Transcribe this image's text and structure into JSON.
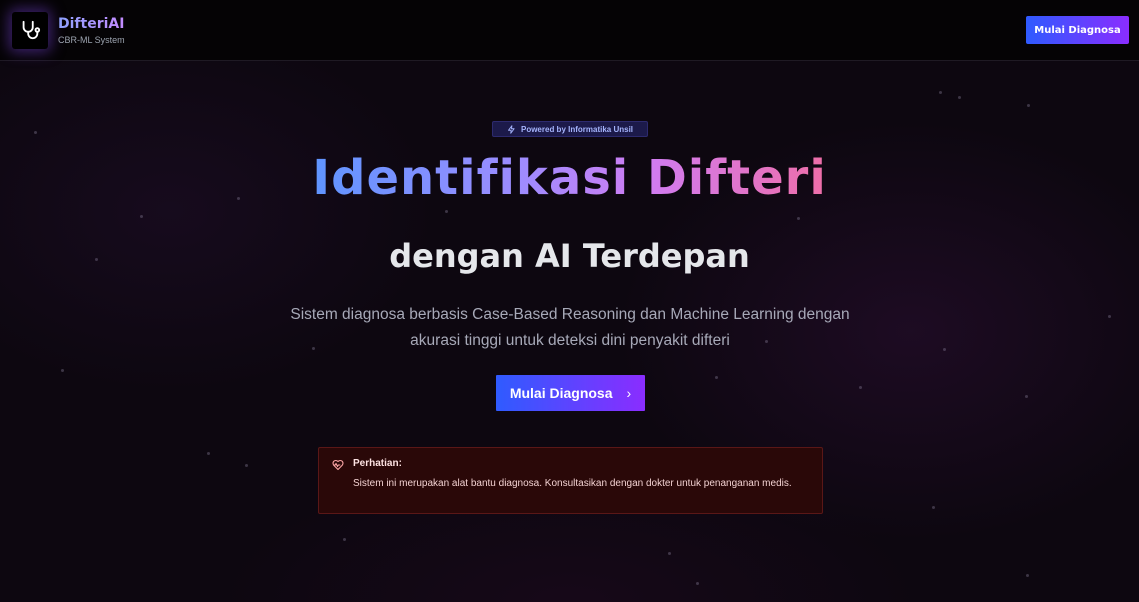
{
  "header": {
    "brand_name": "DifteriAI",
    "brand_subtitle": "CBR-ML System",
    "cta_label": "Mulai Diagnosa",
    "logo_icon": "stethoscope-icon"
  },
  "hero": {
    "badge_icon": "sparkle-icon",
    "badge_label": "Powered by Informatika Unsil",
    "title": "Identifikasi Difteri",
    "subtitle": "dengan AI Terdepan",
    "description_line1": "Sistem diagnosa berbasis Case-Based Reasoning dan Machine Learning dengan",
    "description_line2": "akurasi tinggi untuk deteksi dini penyakit difteri",
    "cta_label": "Mulai Diagnosa",
    "cta_icon": "chevron-right-icon"
  },
  "notice": {
    "icon": "heart-pulse-icon",
    "title": "Perhatian:",
    "text": "Sistem ini merupakan alat bantu diagnosa. Konsultasikan dengan dokter untuk penanganan medis."
  },
  "colors": {
    "accent_start": "#2f5bff",
    "accent_end": "#8a2dff",
    "background": "#0d0710",
    "notice_bg": "#2a0808"
  }
}
